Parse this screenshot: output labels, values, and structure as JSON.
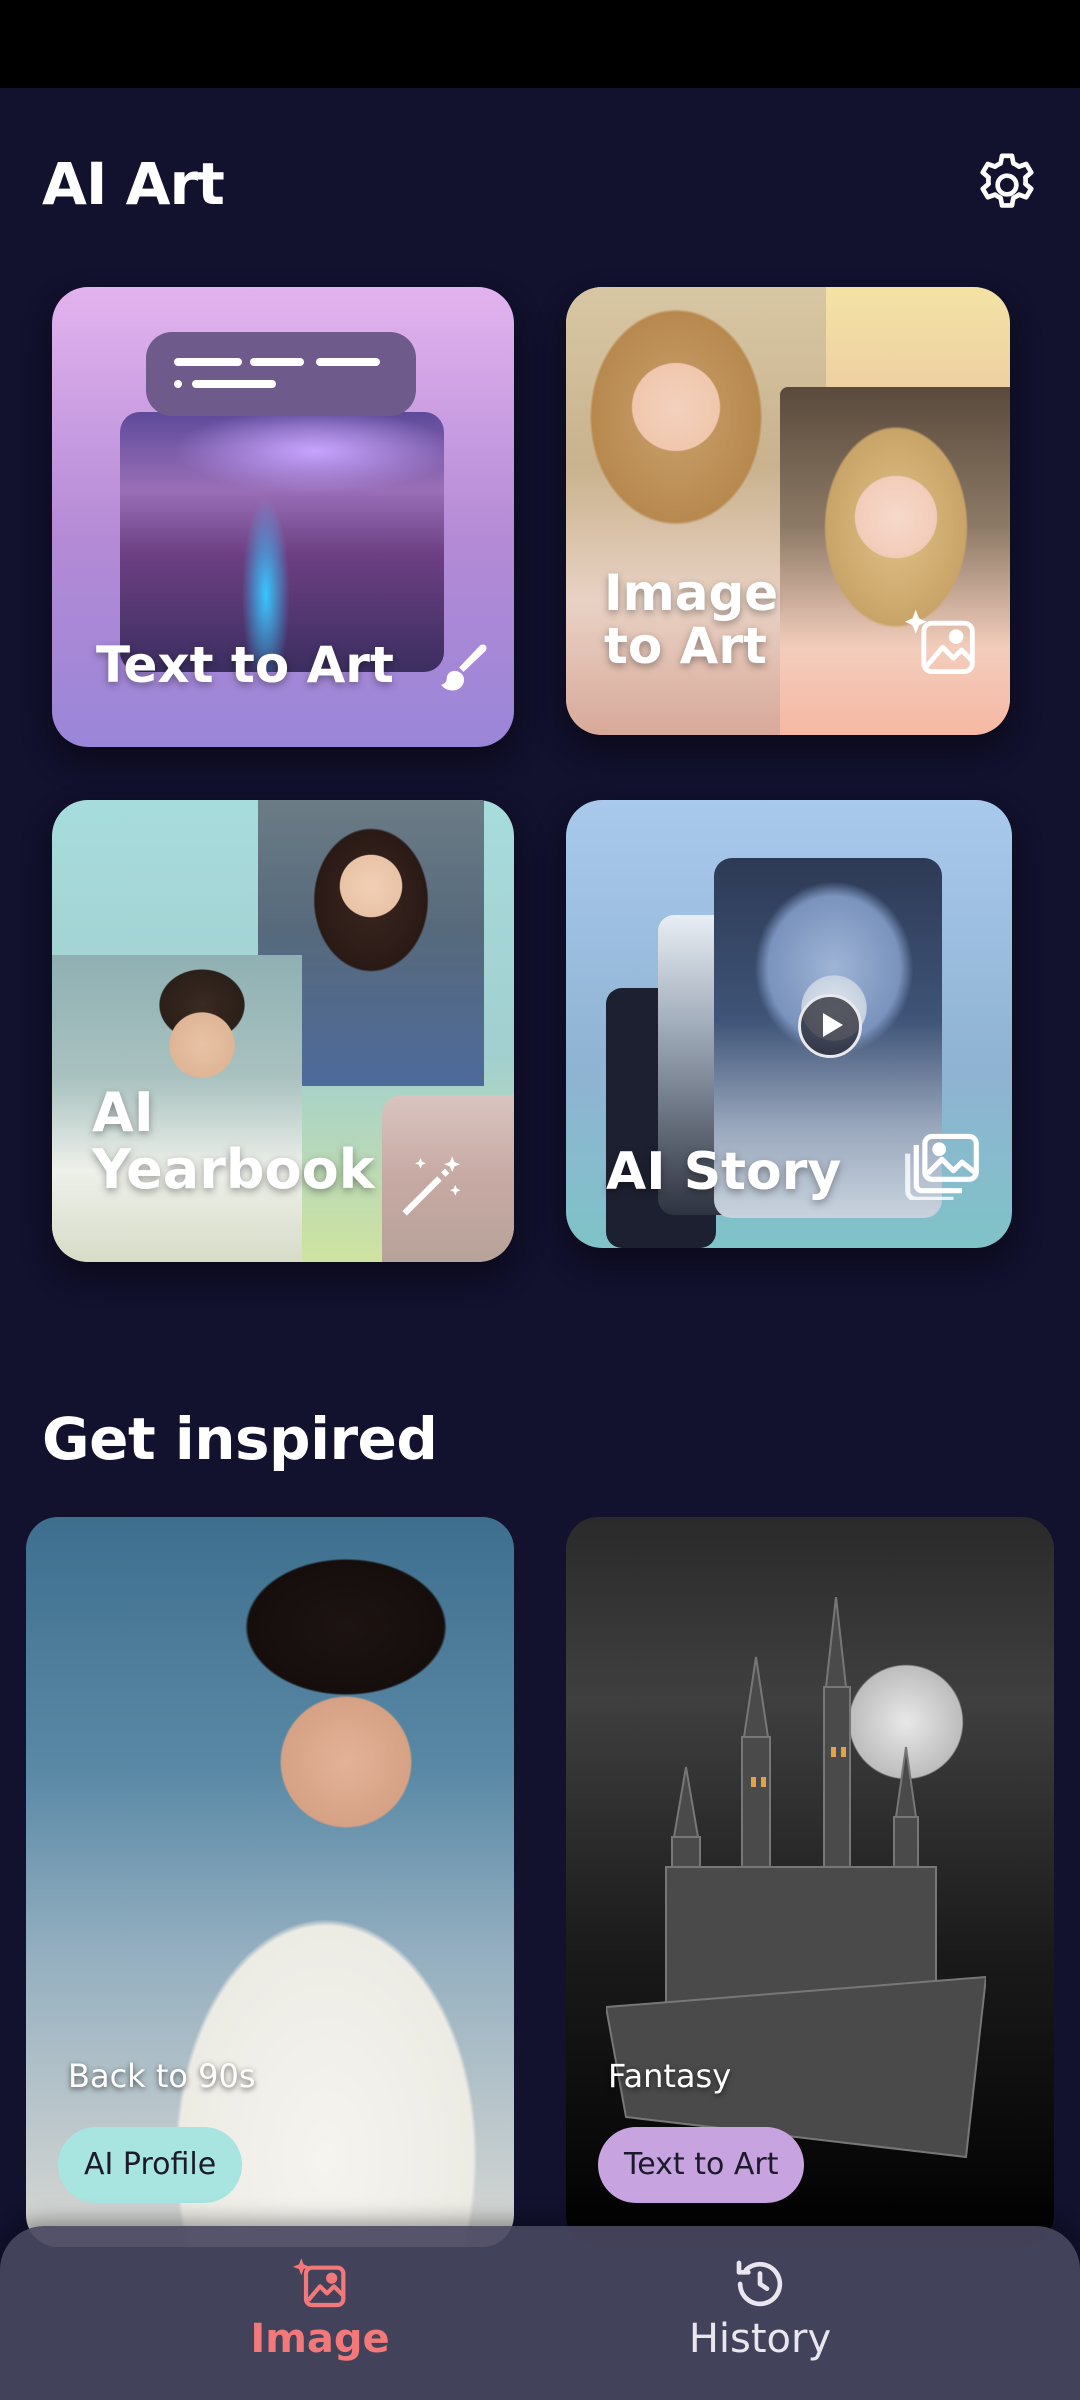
{
  "app": {
    "title": "AI Art"
  },
  "features": {
    "text_to_art": "Text to Art",
    "image_to_art_line1": "Image",
    "image_to_art_line2": "to Art",
    "ai_yearbook_line1": "AI",
    "ai_yearbook_line2": "Yearbook",
    "ai_story": "AI Story"
  },
  "inspire": {
    "title": "Get inspired",
    "cards": [
      {
        "caption": "Back to 90s",
        "tag": "AI Profile"
      },
      {
        "caption": "Fantasy",
        "tag": "Text to Art"
      }
    ]
  },
  "nav": {
    "items": [
      {
        "label": "Image",
        "active": true
      },
      {
        "label": "History",
        "active": false
      }
    ]
  },
  "colors": {
    "background": "#12112e",
    "active_nav": "#f2787a",
    "chip_teal": "#a8e4e0",
    "chip_purple": "#c7a3e0"
  }
}
